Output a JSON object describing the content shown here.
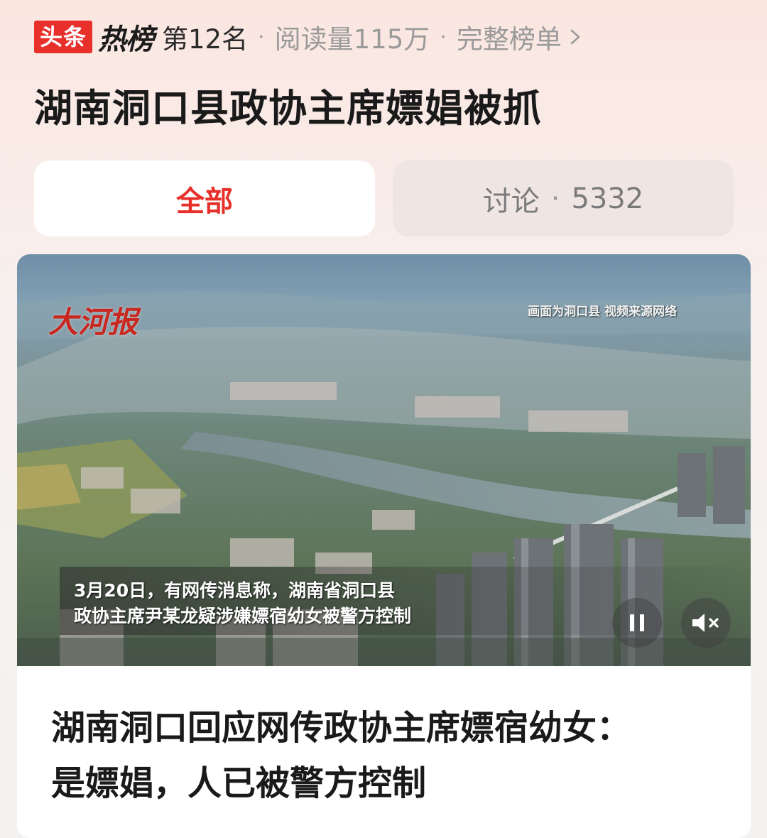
{
  "rank_bar": {
    "brand": "头条",
    "hot_label": "热榜",
    "rank": "第12名",
    "separator": "·",
    "read_count": "阅读量115万",
    "full_list_label": "完整榜单"
  },
  "topic": {
    "title": "湖南洞口县政协主席嫖娼被抓"
  },
  "tabs": {
    "all": "全部",
    "discuss_label": "讨论",
    "discuss_sep": "·",
    "discuss_count": "5332"
  },
  "card": {
    "video": {
      "channel_logo": "大河报",
      "source_note": "画面为洞口县 视频来源网络",
      "subtitle_line1": "3月20日，有网传消息称，湖南省洞口县",
      "subtitle_line2": "政协主席尹某龙疑涉嫌嫖宿幼女被警方控制",
      "controls": [
        "pause-icon",
        "mute-icon"
      ]
    },
    "headline_line1": "湖南洞口回应网传政协主席嫖宿幼女：",
    "headline_line2": "是嫖娼，人已被警方控制"
  },
  "colors": {
    "accent_red": "#e8302b",
    "text_dark": "#1a1a1a",
    "text_gray": "#9a9a9a"
  }
}
